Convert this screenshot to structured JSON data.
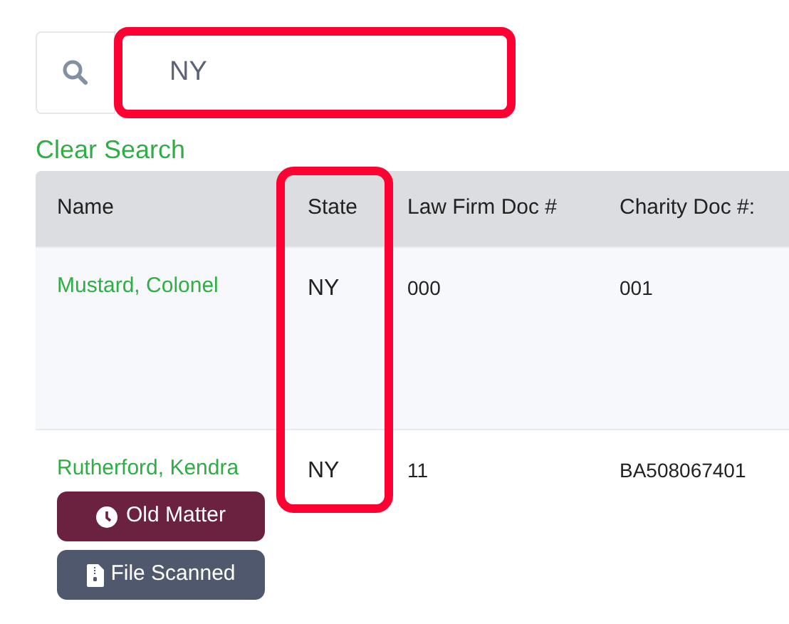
{
  "search": {
    "value": "NY"
  },
  "clear_link": "Clear Search",
  "table": {
    "columns": [
      "Name",
      "State",
      "Law Firm Doc #",
      "Charity Doc #:"
    ],
    "rows": [
      {
        "name": "Mustard, Colonel",
        "state": "NY",
        "law_firm_doc": "000",
        "charity_doc": "001",
        "badges": []
      },
      {
        "name": "Rutherford, Kendra",
        "state": "NY",
        "law_firm_doc": "11",
        "charity_doc": "BA508067401",
        "badges": [
          {
            "kind": "old",
            "label": "Old Matter"
          },
          {
            "kind": "scanned",
            "label": "File Scanned"
          }
        ]
      }
    ]
  }
}
